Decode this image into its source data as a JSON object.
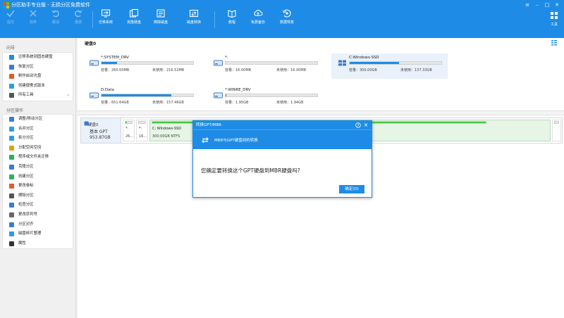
{
  "app": {
    "title": "分区助手专业版 - 无损分区免费软件"
  },
  "window": {
    "buttons": [
      "menu",
      "minimize",
      "maximize",
      "close"
    ]
  },
  "toolbar": {
    "submit": "提交",
    "discard": "放弃",
    "undo": "撤消",
    "redo": "重做",
    "migrate_os": "迁移系统",
    "clone_disk": "克隆硬盘",
    "wipe_disk": "擦除磁盘",
    "disk_convert": "磁盘转换",
    "tutorial": "教程",
    "free_backup": "免费备份",
    "data_recovery": "数据恢复",
    "tools": "工具"
  },
  "sidebar": {
    "wizard_head": "向导",
    "wizard_items": [
      {
        "label": "迁移系统到固态硬盘",
        "icon": "migrate-ssd-icon",
        "color": "#1e8ce6"
      },
      {
        "label": "恢复分区",
        "icon": "recover-partition-icon",
        "color": "#3a7bd5"
      },
      {
        "label": "制作启动光盘",
        "icon": "boot-disc-icon",
        "color": "#e05a2a"
      },
      {
        "label": "创建便携式版本",
        "icon": "portable-icon",
        "color": "#2f9be0"
      },
      {
        "label": "所有工具",
        "icon": "all-tools-icon",
        "color": "#555555"
      }
    ],
    "ops_head": "分区操作",
    "ops_items": [
      {
        "label": "调整/移动分区",
        "icon": "resize-icon",
        "color": "#3a7bd5"
      },
      {
        "label": "合并分区",
        "icon": "merge-icon",
        "color": "#2f9be0"
      },
      {
        "label": "拆分分区",
        "icon": "split-icon",
        "color": "#2f9be0"
      },
      {
        "label": "分配空闲空间",
        "icon": "allocate-icon",
        "color": "#e0a020"
      },
      {
        "label": "程序或文件夹迁移",
        "icon": "app-move-icon",
        "color": "#2fae5c"
      },
      {
        "label": "克隆分区",
        "icon": "clone-partition-icon",
        "color": "#3a7bd5"
      },
      {
        "label": "创建分区",
        "icon": "create-partition-icon",
        "color": "#2fae5c"
      },
      {
        "label": "更改卷标",
        "icon": "label-icon",
        "color": "#e05a2a"
      },
      {
        "label": "擦除分区",
        "icon": "wipe-partition-icon",
        "color": "#555555"
      },
      {
        "label": "检查分区",
        "icon": "check-icon",
        "color": "#3a7bd5"
      },
      {
        "label": "更改序列号",
        "icon": "serial-icon",
        "color": "#666666"
      },
      {
        "label": "分区对齐",
        "icon": "align-icon",
        "color": "#3a7bd5"
      },
      {
        "label": "磁盘碎片整理",
        "icon": "defrag-icon",
        "color": "#2f9be0"
      },
      {
        "label": "属性",
        "icon": "properties-icon",
        "color": "#333333"
      }
    ]
  },
  "main": {
    "disk_title": "硬盘0",
    "partitions_cards": [
      {
        "name": "*:SYSTEM_DRV",
        "capacity": "容量：260.00MB",
        "free": "未使用：216.52MB",
        "used_fraction": 0.17
      },
      {
        "name": "*:",
        "capacity": "容量：16.00MB",
        "free": "未使用：16.00MB",
        "used_fraction": 0.0
      },
      {
        "name": "C:Windows-SSD",
        "capacity": "容量：300.00GB",
        "free": "未使用：137.33GB",
        "used_fraction": 0.54
      },
      {
        "name": "D:Data",
        "capacity": "容量：651.64GB",
        "free": "未使用：157.46GB",
        "used_fraction": 0.76
      },
      {
        "name": "*:WINRE_DRV",
        "capacity": "容量：1.95GB",
        "free": "未使用：1.94GB",
        "used_fraction": 0.01
      }
    ],
    "disk_row": {
      "name": "硬盘0",
      "type": "基本 GPT",
      "size": "953.87GB",
      "parts": [
        {
          "label": "*:",
          "sub": "26..."
        },
        {
          "label": "*:",
          "sub": "16..."
        },
        {
          "label": "C: Windows-SSD",
          "sub": "300.00GB NTFS"
        }
      ]
    }
  },
  "dialog": {
    "title": "转换GPT/MBR",
    "banner": "MBR与GPT硬盘间的转换",
    "message": "您确定要转换这个GPT硬盘到MBR硬盘吗?",
    "ok": "确定(O)"
  }
}
